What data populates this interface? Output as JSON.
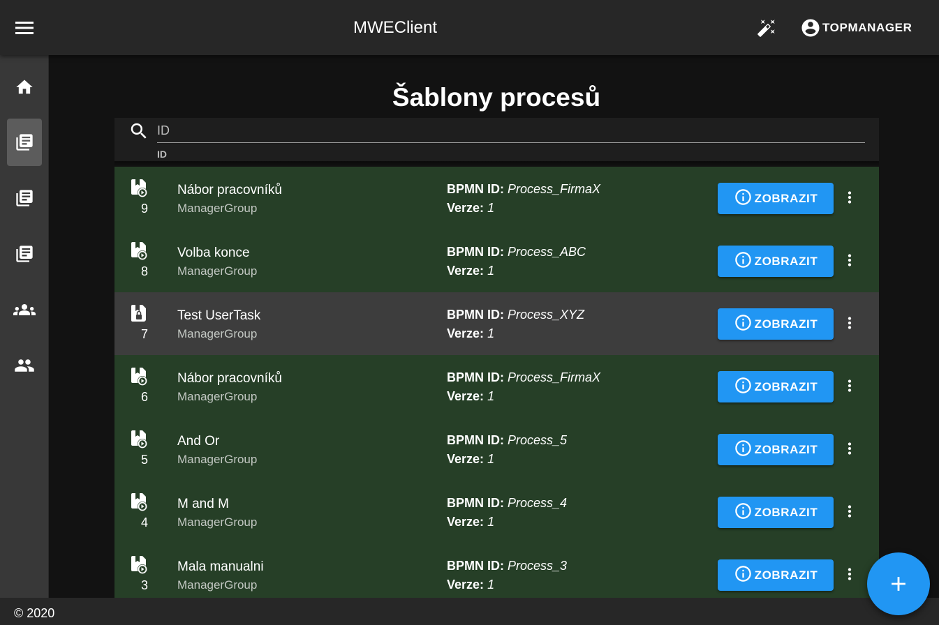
{
  "topbar": {
    "title": "MWEClient",
    "menu_icon": "menu-icon",
    "theme_icon": "theme-toggle-icon",
    "user_icon": "account-circle-icon",
    "user_name": "TOPMANAGER"
  },
  "sidebar": {
    "items": [
      {
        "name": "home",
        "icon": "home-icon",
        "active": false
      },
      {
        "name": "process-templates",
        "icon": "library-books-icon",
        "active": true
      },
      {
        "name": "processes",
        "icon": "library-books-icon",
        "active": false
      },
      {
        "name": "tasks",
        "icon": "library-books-icon",
        "active": false
      },
      {
        "name": "groups",
        "icon": "groups-icon",
        "active": false
      },
      {
        "name": "users",
        "icon": "people-icon",
        "active": false
      }
    ]
  },
  "page": {
    "title": "Šablony procesů"
  },
  "search": {
    "placeholder": "ID",
    "helper": "ID",
    "icon": "search-icon"
  },
  "labels": {
    "bpmn_id": "BPMN ID:",
    "version": "Verze:",
    "show_button": "ZOBRAZIT"
  },
  "colors": {
    "row_active": "#263f27",
    "row_inactive": "#3d3d3d",
    "accent": "#2196f3"
  },
  "templates": [
    {
      "number": "9",
      "name": "Nábor pracovníků",
      "group": "ManagerGroup",
      "bpmn_id": "Process_FirmaX",
      "version": "1",
      "status_icon": "play-file-icon",
      "active": true
    },
    {
      "number": "8",
      "name": "Volba konce",
      "group": "ManagerGroup",
      "bpmn_id": "Process_ABC",
      "version": "1",
      "status_icon": "play-file-icon",
      "active": true
    },
    {
      "number": "7",
      "name": "Test UserTask",
      "group": "ManagerGroup",
      "bpmn_id": "Process_XYZ",
      "version": "1",
      "status_icon": "lock-file-icon",
      "active": false
    },
    {
      "number": "6",
      "name": "Nábor pracovníků",
      "group": "ManagerGroup",
      "bpmn_id": "Process_FirmaX",
      "version": "1",
      "status_icon": "play-file-icon",
      "active": true
    },
    {
      "number": "5",
      "name": "And Or",
      "group": "ManagerGroup",
      "bpmn_id": "Process_5",
      "version": "1",
      "status_icon": "play-file-icon",
      "active": true
    },
    {
      "number": "4",
      "name": "M and M",
      "group": "ManagerGroup",
      "bpmn_id": "Process_4",
      "version": "1",
      "status_icon": "play-file-icon",
      "active": true
    },
    {
      "number": "3",
      "name": "Mala manualni",
      "group": "ManagerGroup",
      "bpmn_id": "Process_3",
      "version": "1",
      "status_icon": "play-file-icon",
      "active": true
    }
  ],
  "footer": {
    "copyright": "© 2020"
  },
  "fab": {
    "icon": "plus-icon"
  }
}
